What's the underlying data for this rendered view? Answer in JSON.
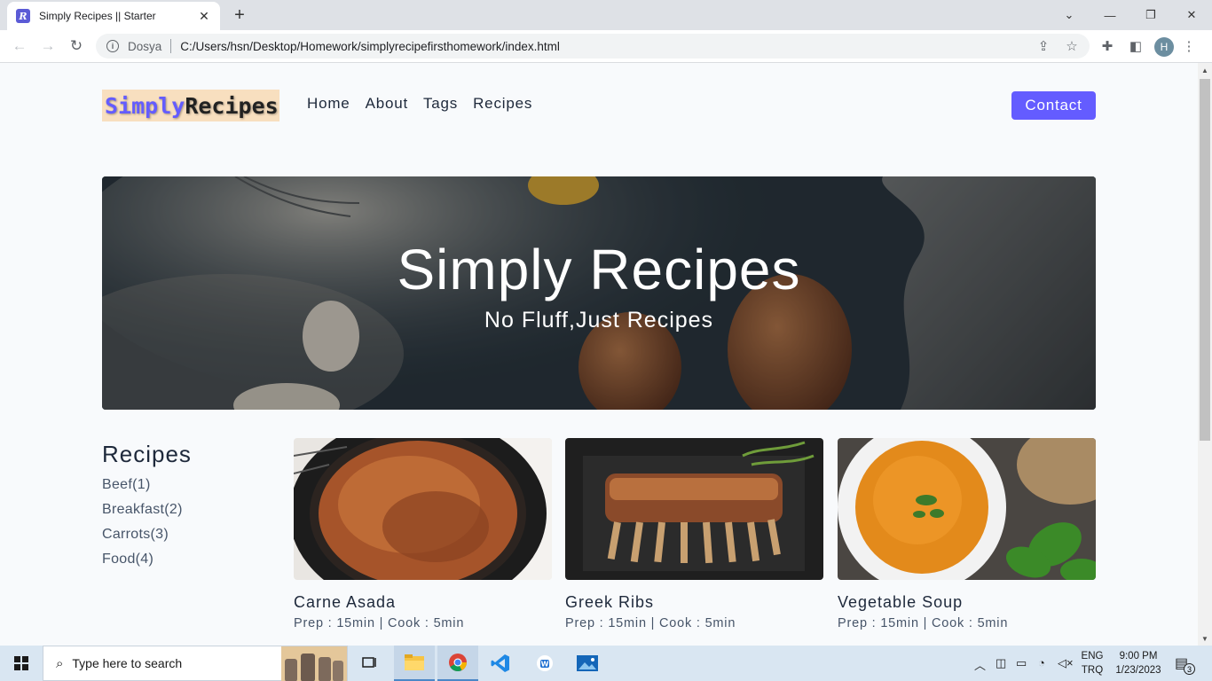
{
  "browser": {
    "tab_title": "Simply Recipes || Starter",
    "favicon_letter": "R",
    "origin": "Dosya",
    "url": "C:/Users/hsn/Desktop/Homework/simplyrecipefirsthomework/index.html",
    "profile_initial": "H"
  },
  "site": {
    "logo_part1": "Simply",
    "logo_part2": "Recipes",
    "nav": [
      "Home",
      "About",
      "Tags",
      "Recipes"
    ],
    "contact_label": "Contact",
    "hero_title": "Simply Recipes",
    "hero_subtitle": "No Fluff,Just Recipes",
    "sidebar_title": "Recipes",
    "tags": [
      "Beef(1)",
      "Breakfast(2)",
      "Carrots(3)",
      "Food(4)"
    ],
    "recipes": [
      {
        "title": "Carne Asada",
        "meta": "Prep : 15min | Cook : 5min"
      },
      {
        "title": "Greek Ribs",
        "meta": "Prep : 15min | Cook : 5min"
      },
      {
        "title": "Vegetable Soup",
        "meta": "Prep : 15min | Cook : 5min"
      }
    ]
  },
  "taskbar": {
    "search_placeholder": "Type here to search",
    "lang_top": "ENG",
    "lang_bottom": "TRQ",
    "time": "9:00 PM",
    "date": "1/23/2023",
    "notification_count": "3"
  },
  "colors": {
    "accent": "#645cff",
    "logo_bg": "#f8dfbf"
  }
}
